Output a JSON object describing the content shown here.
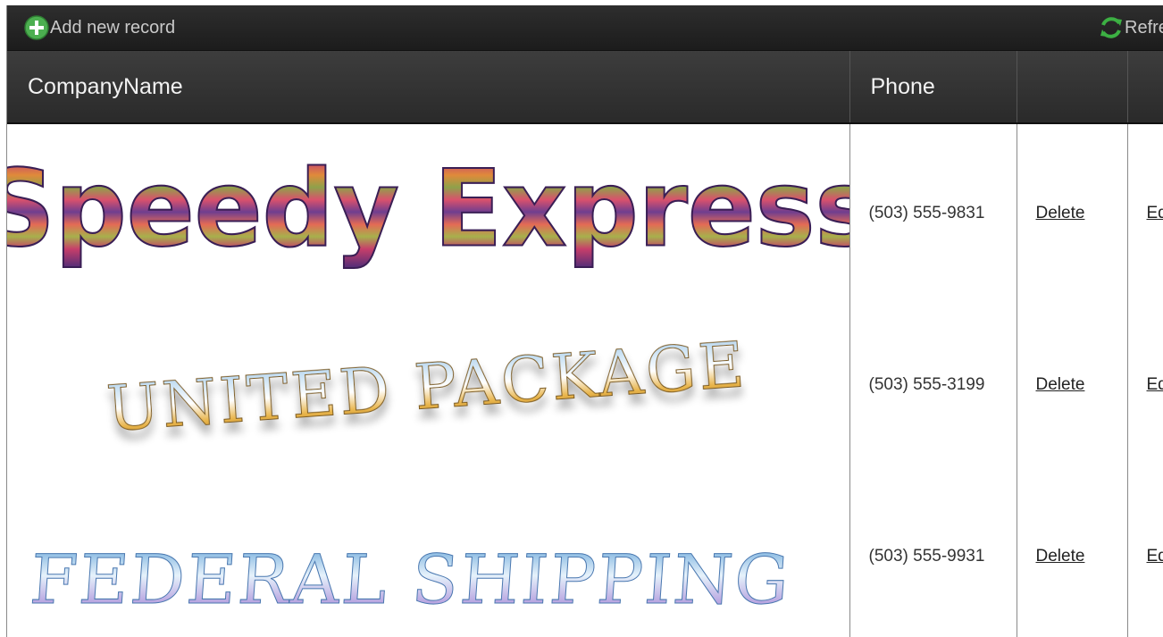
{
  "toolbar": {
    "add_label": "Add new record",
    "add_icon": "add-circle-icon",
    "refresh_label": "Refresh",
    "refresh_icon": "refresh-icon"
  },
  "columns": [
    "CompanyName",
    "Phone",
    "",
    ""
  ],
  "rows": [
    {
      "company": "Speedy Express",
      "phone": "(503) 555-9831",
      "delete_label": "Delete",
      "edit_label": "Edit"
    },
    {
      "company": "United Package",
      "phone": "(503) 555-3199",
      "delete_label": "Delete",
      "edit_label": "Edit"
    },
    {
      "company": "Federal Shipping",
      "phone": "(503) 555-9931",
      "delete_label": "Delete",
      "edit_label": "Edit"
    }
  ],
  "colors": {
    "toolbar_bg": "#232323",
    "header_bg": "#353535",
    "add_icon_green": "#4caf50",
    "refresh_icon_green": "#3cb043"
  }
}
